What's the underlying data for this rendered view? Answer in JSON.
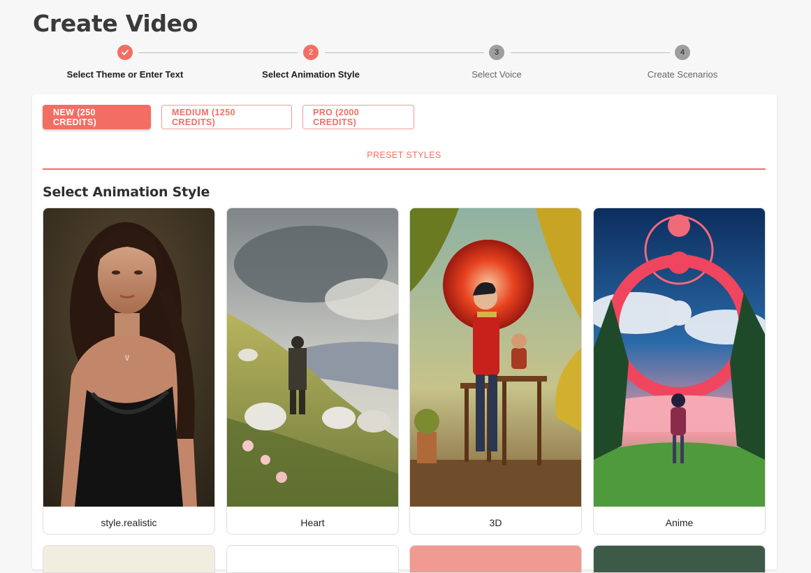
{
  "page": {
    "title": "Create Video"
  },
  "stepper": {
    "steps": [
      {
        "number": "1",
        "label": "Select Theme or Enter Text",
        "state": "done"
      },
      {
        "number": "2",
        "label": "Select Animation Style",
        "state": "active"
      },
      {
        "number": "3",
        "label": "Select Voice",
        "state": "pending"
      },
      {
        "number": "4",
        "label": "Create Scenarios",
        "state": "pending"
      }
    ]
  },
  "plans": [
    {
      "label": "NEW (250 CREDITS)",
      "selected": true
    },
    {
      "label": "MEDIUM (1250 CREDITS)",
      "selected": false
    },
    {
      "label": "PRO (2000 CREDITS)",
      "selected": false
    }
  ],
  "tabs": {
    "preset": "PRESET STYLES"
  },
  "section": {
    "title": "Select Animation Style"
  },
  "styles": [
    {
      "label": "style.realistic",
      "icon": "realistic-portrait-image"
    },
    {
      "label": "Heart",
      "icon": "oil-painting-shepherd-image"
    },
    {
      "label": "3D",
      "icon": "3d-render-boy-image"
    },
    {
      "label": "Anime",
      "icon": "anime-girl-image"
    }
  ],
  "colors": {
    "accent": "#f26e63",
    "pending": "#9e9e9e",
    "background": "#f7f7f7"
  }
}
